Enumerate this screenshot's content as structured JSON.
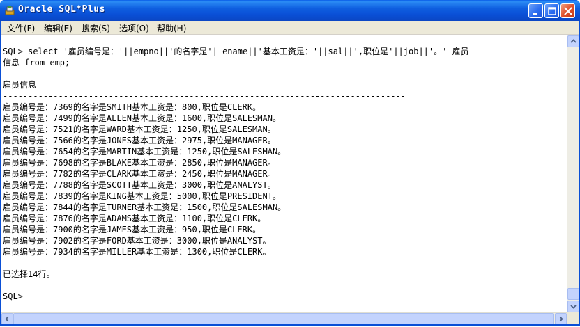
{
  "window": {
    "title": "Oracle SQL*Plus"
  },
  "menu": {
    "items": [
      {
        "label": "文件(F)"
      },
      {
        "label": "编辑(E)"
      },
      {
        "label": "搜索(S)"
      },
      {
        "label": "选项(O)"
      },
      {
        "label": "帮助(H)"
      }
    ]
  },
  "console": {
    "lines": [
      "SQL> select '雇员编号是：'||empno||'的名字是'||ename||'基本工资是：'||sal||',职位是'||job||'。' 雇员",
      "信息 from emp;",
      "",
      "雇员信息",
      "--------------------------------------------------------------------------------",
      "雇员编号是：7369的名字是SMITH基本工资是：800,职位是CLERK。",
      "雇员编号是：7499的名字是ALLEN基本工资是：1600,职位是SALESMAN。",
      "雇员编号是：7521的名字是WARD基本工资是：1250,职位是SALESMAN。",
      "雇员编号是：7566的名字是JONES基本工资是：2975,职位是MANAGER。",
      "雇员编号是：7654的名字是MARTIN基本工资是：1250,职位是SALESMAN。",
      "雇员编号是：7698的名字是BLAKE基本工资是：2850,职位是MANAGER。",
      "雇员编号是：7782的名字是CLARK基本工资是：2450,职位是MANAGER。",
      "雇员编号是：7788的名字是SCOTT基本工资是：3000,职位是ANALYST。",
      "雇员编号是：7839的名字是KING基本工资是：5000,职位是PRESIDENT。",
      "雇员编号是：7844的名字是TURNER基本工资是：1500,职位是SALESMAN。",
      "雇员编号是：7876的名字是ADAMS基本工资是：1100,职位是CLERK。",
      "雇员编号是：7900的名字是JAMES基本工资是：950,职位是CLERK。",
      "雇员编号是：7902的名字是FORD基本工资是：3000,职位是ANALYST。",
      "雇员编号是：7934的名字是MILLER基本工资是：1300,职位是CLERK。",
      "",
      "已选择14行。",
      "",
      "SQL>"
    ]
  },
  "icons": {
    "app": "oracle-app-icon",
    "minimize": "minimize-icon",
    "maximize": "maximize-icon",
    "close": "close-icon"
  },
  "colors": {
    "titlebar": "#0a4fd6",
    "menubar": "#ece9d8",
    "console_bg": "#ffffff",
    "text": "#000000",
    "scrollbar": "#c3d3fd"
  }
}
